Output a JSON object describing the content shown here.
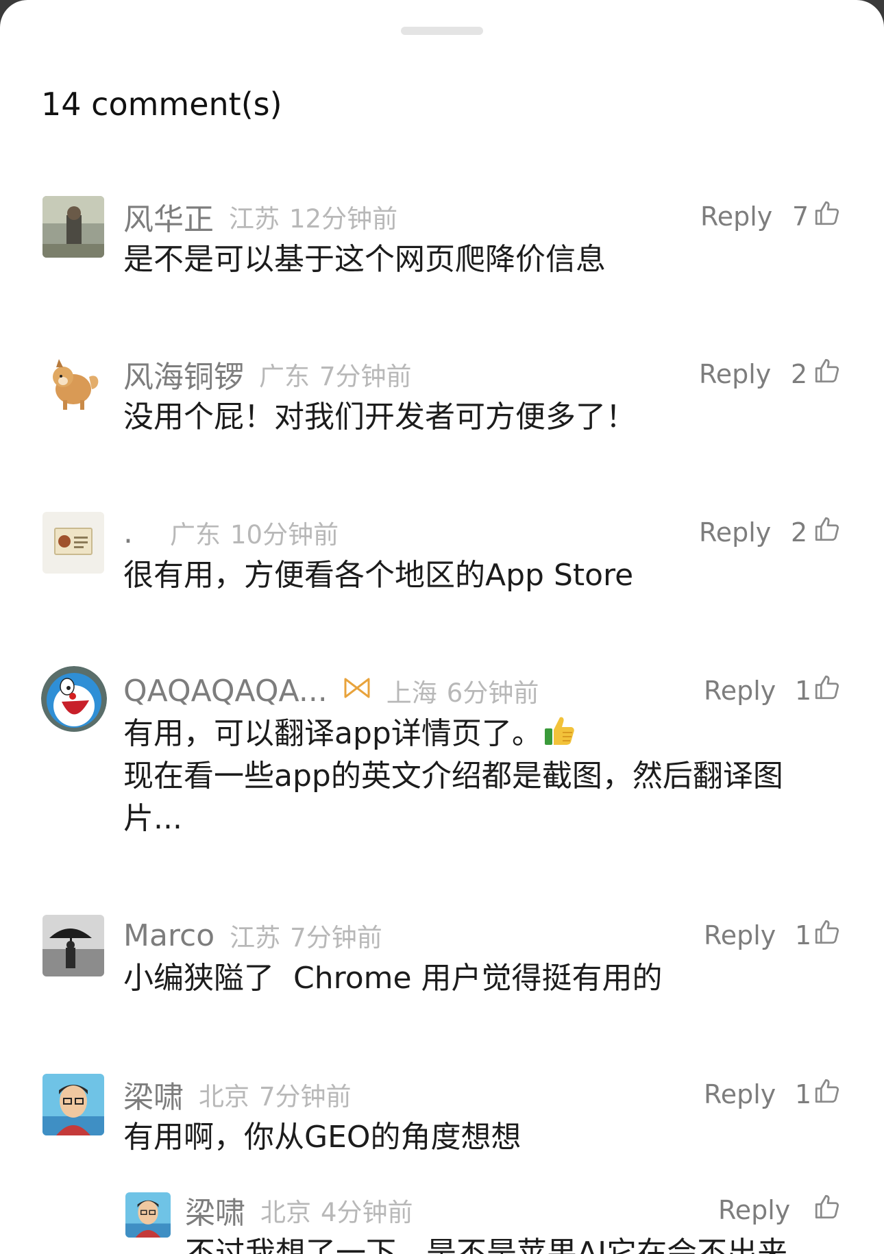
{
  "sheet": {
    "comment_count": "14 comment(s)"
  },
  "comments": [
    {
      "user": "风华正",
      "location": "江苏",
      "time": "12分钟前",
      "reply": "Reply",
      "likes": "7",
      "text": "是不是可以基于这个网页爬降价信息"
    },
    {
      "user": "风海铜锣",
      "location": "广东",
      "time": "7分钟前",
      "reply": "Reply",
      "likes": "2",
      "text": "没用个屁！对我们开发者可方便多了！"
    },
    {
      "user": ".",
      "location": "广东",
      "time": "10分钟前",
      "reply": "Reply",
      "likes": "2",
      "text": "很有用，方便看各个地区的App Store"
    },
    {
      "user": "QAQAQAQA...",
      "location": "上海",
      "time": "6分钟前",
      "reply": "Reply",
      "likes": "1",
      "text_line1": "有用，可以翻译app详情页了。",
      "text_line2": "现在看一些app的英文介绍都是截图，然后翻译图片...",
      "emoji": "thumbs-up-emoji"
    },
    {
      "user": "Marco",
      "location": "江苏",
      "time": "7分钟前",
      "reply": "Reply",
      "likes": "1",
      "text": "小编狭隘了  Chrome 用户觉得挺有用的"
    },
    {
      "user": "梁啸",
      "location": "北京",
      "time": "7分钟前",
      "reply": "Reply",
      "likes": "1",
      "text": "有用啊，你从GEO的角度想想"
    }
  ],
  "sub_reply": {
    "user": "梁啸",
    "location": "北京",
    "time": "4分钟前",
    "reply": "Reply",
    "likes": "",
    "text": "不过我想了一下，是不是苹果AI它在会不出来"
  },
  "icons": {
    "like": "thumbs-up-outline-icon",
    "vip": "vip-badge-icon"
  },
  "colors": {
    "username": "#7d7d7d",
    "meta": "#b8b8b8",
    "body": "#1c1c1c",
    "vip": "#e8a33c"
  }
}
